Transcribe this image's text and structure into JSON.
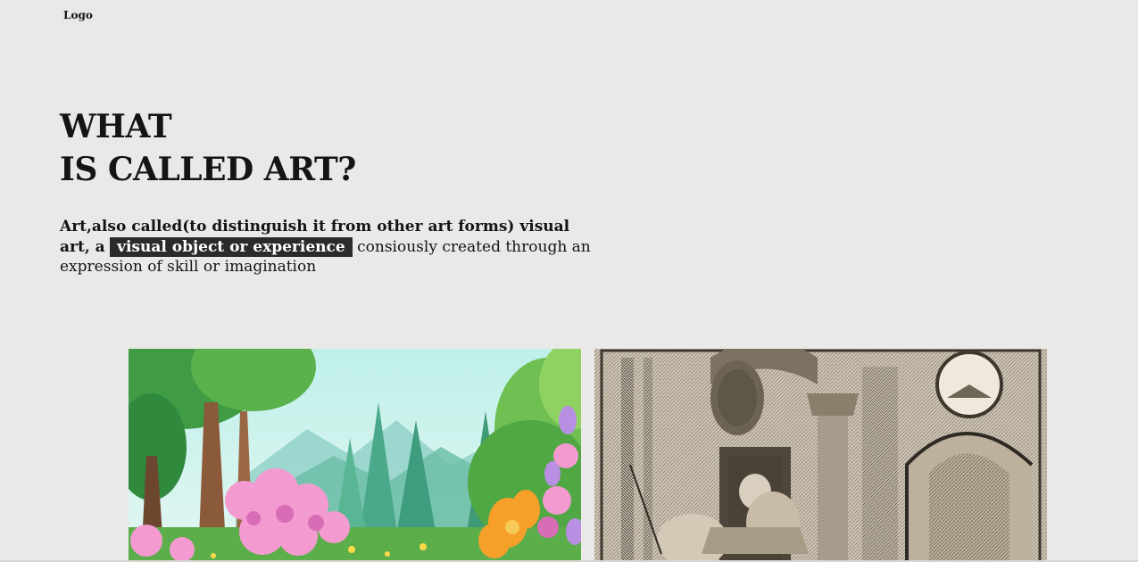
{
  "header": {
    "logo_text": "Logo"
  },
  "hero": {
    "title_line1": "WHAT",
    "title_line2": "IS CALLED ART?",
    "desc_lead": "Art,also called(to distinguish it from other art forms) visual art, a",
    "desc_highlight": "visual object or experience",
    "desc_rest": "consiously created through an expression of skill or imagination"
  },
  "gallery": {
    "items": [
      {
        "icon": "spring-garden-painting",
        "alt": ""
      },
      {
        "icon": "engraving-artwork",
        "alt": ""
      }
    ]
  },
  "colors": {
    "background": "#ebe9e7",
    "text": "#141414",
    "highlight_bg": "#2b2b2b",
    "highlight_text": "#ffffff"
  }
}
